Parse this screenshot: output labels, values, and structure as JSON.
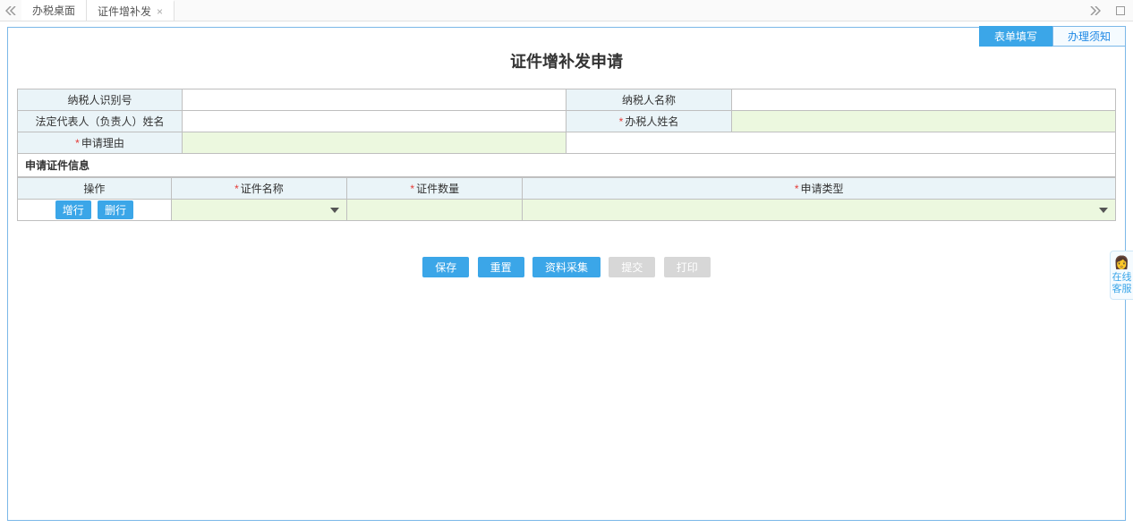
{
  "topbar": {
    "tabs": [
      {
        "label": "办税桌面",
        "closable": false
      },
      {
        "label": "证件增补发",
        "closable": true
      }
    ]
  },
  "panel": {
    "tabs": [
      {
        "label": "表单填写",
        "active": true
      },
      {
        "label": "办理须知",
        "active": false
      }
    ]
  },
  "page_title": "证件增补发申请",
  "form": {
    "taxpayer_id_label": "纳税人识别号",
    "taxpayer_id_value": "",
    "taxpayer_name_label": "纳税人名称",
    "taxpayer_name_value": "",
    "legal_rep_label": "法定代表人（负责人）姓名",
    "legal_rep_value": "",
    "agent_name_label": "办税人姓名",
    "agent_name_value": "",
    "apply_reason_label": "申请理由",
    "apply_reason_value": ""
  },
  "section": {
    "title": "申请证件信息",
    "columns": {
      "op": "操作",
      "cert_name": "证件名称",
      "cert_qty": "证件数量",
      "apply_type": "申请类型"
    },
    "row_ops": {
      "add": "增行",
      "del": "删行"
    },
    "row": {
      "cert_name": "",
      "cert_qty": "",
      "apply_type": ""
    }
  },
  "actions": {
    "save": "保存",
    "reset": "重置",
    "materials": "资料采集",
    "submit": "提交",
    "print": "打印"
  },
  "sidewidget": {
    "label": "在线客服"
  }
}
